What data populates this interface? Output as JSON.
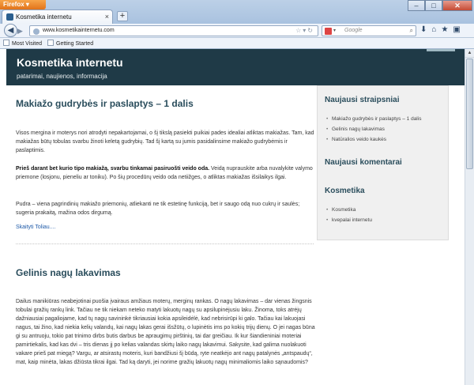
{
  "browser": {
    "menu_button": "Firefox",
    "tab_title": "Kosmetika internetu",
    "new_tab": "+",
    "url": "www.kosmetikainternetu.com",
    "search_placeholder": "Google",
    "bookmarks": [
      "Most Visited",
      "Getting Started"
    ]
  },
  "site": {
    "title": "Kosmetika internetu",
    "tagline": "patarimai, naujienos, informacija"
  },
  "posts": [
    {
      "title": "Makiažo gudrybės ir paslaptys – 1 dalis",
      "paragraphs": [
        {
          "bold": "",
          "text": "Visos mergina ir moterys nori atrodyti nepakartojamai, o šį tikslą pasiekti puikiai pades idealiai atliktas makiažas. Tam, kad makiažas būtų tobulas svarbu žinoti keletą gudrybių. Tad šį kartą su jumis pasidalinsime makiažo gudrybėmis ir paslaptimis."
        },
        {
          "bold": "Prieš darant bet kurio tipo makiažą, svarbu tinkamai pasiruošti veido oda.",
          "text": " Veidą nuprauskite arba nuvalykite valymo priemone (losjonu, pieneliu ar toniku). Po šių procedūrų veido oda netiižges, o atliktas makiažas išsilaikys ilgai."
        },
        {
          "bold": "",
          "text": "Pudra – viena pagrindinių makiažo priemonių, atliekanti ne tik estetinę funkciją, bet ir saugo odą nuo cukrų ir saulės; sugeria prakaitą, mažina odos dirgumą."
        }
      ],
      "read_more": "Skaityti Toliau...."
    },
    {
      "title": "Gelinis nagų lakavimas",
      "paragraphs": [
        {
          "bold": "",
          "text": "Dailus manikiūras neabejotinai puošia įvairaus amžiaus moterų, merginų rankas. O nagų lakavimas – dar vienas žingsnis tobulai gražių rankų link. Tačiau ne tik niekam neteko matyti lakuotų nagų su apsilupinėjusiu laku. Žinoma, toks atrėjų dažniausiai pagaliojame, kad tų nagų savininkė tikriausiai kokia apsileidėlė, kad nebrisirūpi ki galo. Tačiau kai lakuojasi nagus, tai žino, kad niekia kelių valandų, kai nagų lakas gerai išsžūtų, o lupinėtis ims po kokių trijų dienų. O jei nagas būna gi su antruoju, tokio pat trinimo dirbs butis darbus be apraugimų pirštinių, tai dar greičiau. Ik kur šiandieniniai moteriai pamirtiekalis, kad kas dvi – tris dienas jį po kelias valandas skirtų laiko nagų lakavimui. Sakysite, kad galima nuolakuoti vakare prieš pat miegą? Vargu, ar atsirastų moteris, kuri bandžiusi šį būdą, ryte neatkėjo ant nagų patalynės „antspaudų“, mat, kaip minėta, lakas džiūsta tikrai ilgai. Tad ką daryti, jei norime gražių lakuotų nagų minimaliomis laiko sąnaudomis?"
        }
      ]
    }
  ],
  "sidebar": {
    "sections": [
      {
        "title": "Naujausi straipsniai",
        "items": [
          "Makiažo gudrybės ir paslaptys – 1 dalis",
          "Gelinis nagų lakavimas",
          "Natūralios veido kaukės"
        ]
      },
      {
        "title": "Naujausi komentarai",
        "items": []
      },
      {
        "title": "Kosmetika",
        "items": [
          "Kosmetika",
          "kvepalai internetu"
        ]
      }
    ]
  }
}
